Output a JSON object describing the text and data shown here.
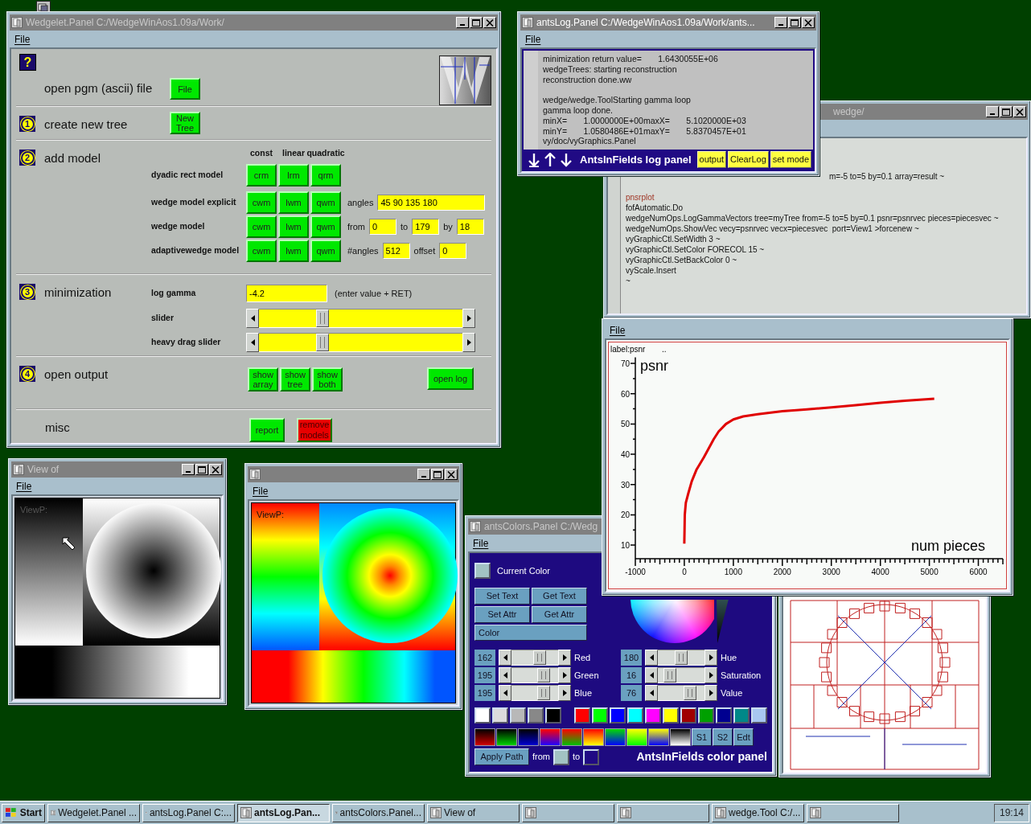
{
  "editor_window": {
    "title": "wedge/",
    "active": false,
    "lines": [
      {
        "kind": "tail",
        "text": "m=-5 to=5 by=0.1 array=result ~"
      },
      {
        "kind": "blank"
      },
      {
        "kind": "label",
        "text": "pnsrplot"
      },
      {
        "kind": "code",
        "text": "fofAutomatic.Do"
      },
      {
        "kind": "code",
        "text": "wedgeNumOps.LogGammaVectors tree=myTree from=-5 to=5 by=0.1 psnr=psnrvec pieces=piecesvec ~"
      },
      {
        "kind": "code",
        "text": "wedgeNumOps.ShowVec vecy=psnrvec vecx=piecesvec  port=View1 >forcenew ~"
      },
      {
        "kind": "code",
        "text": "vyGraphicCtl.SetWidth 3 ~"
      },
      {
        "kind": "code",
        "text": "vyGraphicCtl.SetColor FORECOL 15 ~"
      },
      {
        "kind": "code",
        "text": "vyGraphicCtl.SetBackColor 0 ~"
      },
      {
        "kind": "code",
        "text": "vyScale.Insert"
      },
      {
        "kind": "code",
        "text": "~"
      }
    ]
  },
  "wedgelet_panel": {
    "title": "Wedgelet.Panel C:/WedgeWinAos1.09a/Work/",
    "active": false,
    "menu": [
      "File"
    ],
    "help_glyph": "?",
    "open_file": {
      "label": "open pgm (ascii) file",
      "button": "File"
    },
    "sections": [
      {
        "step": "1",
        "title": "create new tree",
        "kind": "single",
        "button": "New Tree"
      },
      {
        "step": "2",
        "title": "add model",
        "kind": "models",
        "columns": [
          "const",
          "linear",
          "quadratic"
        ],
        "rows": [
          {
            "label": "dyadic rect model",
            "buttons": [
              "crm",
              "lrm",
              "qrm"
            ]
          },
          {
            "label": "wedge model explicit",
            "buttons": [
              "cwm",
              "lwm",
              "qwm"
            ],
            "fields": [
              {
                "label": "angles",
                "value": "45 90 135 180"
              }
            ]
          },
          {
            "label": "wedge model",
            "buttons": [
              "cwm",
              "lwm",
              "qwm"
            ],
            "fields": [
              {
                "label": "from",
                "value": "0"
              },
              {
                "label": "to",
                "value": "179"
              },
              {
                "label": "by",
                "value": "18"
              }
            ]
          },
          {
            "label": "adaptivewedge model",
            "buttons": [
              "cwm",
              "lwm",
              "qwm"
            ],
            "fields": [
              {
                "label": "#angles",
                "value": "512"
              },
              {
                "label": "offset",
                "value": "0"
              }
            ]
          }
        ]
      },
      {
        "step": "3",
        "title": "minimization",
        "kind": "minimization",
        "gamma": {
          "label": "log gamma",
          "value": "-4.2",
          "hint": "(enter value + RET)"
        },
        "sliders": [
          {
            "label": "slider",
            "level": 0.3
          },
          {
            "label": "heavy drag slider",
            "level": 0.3
          }
        ]
      },
      {
        "step": "4",
        "title": "open output",
        "kind": "output",
        "buttons": [
          "show array",
          "show tree",
          "show both"
        ],
        "log_button": "open log"
      },
      {
        "title": "misc",
        "kind": "misc",
        "buttons": [
          {
            "label": "report",
            "color": "#00e800"
          },
          {
            "label": "remove models",
            "color": "#e80000"
          }
        ]
      }
    ]
  },
  "antslog_panel": {
    "title": "antsLog.Panel C:/WedgeWinAos1.09a/Work/ants...",
    "active": true,
    "menu": [
      "File"
    ],
    "lines": [
      {
        "kind": "text",
        "text": "minimization return value=       1.6430055E+06"
      },
      {
        "kind": "text",
        "text": "wedgeTrees: starting reconstruction"
      },
      {
        "kind": "text",
        "text": "reconstruction done.ww"
      },
      {
        "kind": "blank"
      },
      {
        "kind": "text",
        "text": "wedge/wedge.ToolStarting gamma loop"
      },
      {
        "kind": "text",
        "text": "gamma loop done."
      },
      {
        "kind": "text",
        "text": "minX=       1.0000000E+00maxX=       5.1020000E+03"
      },
      {
        "kind": "text",
        "text": "minY=       1.0580486E+01maxY=       5.8370457E+01"
      },
      {
        "kind": "text",
        "text": "vy/doc/vyGraphics.Panel"
      }
    ],
    "footer_title": "AntsInFields log panel",
    "buttons": [
      "output",
      "ClearLog",
      "set mode"
    ]
  },
  "colors_panel": {
    "title": "antsColors.Panel C:/Wedg",
    "active": false,
    "menu": [
      "File"
    ],
    "current_color": {
      "label": "Current Color",
      "color": "#a2c3c3"
    },
    "buttons": [
      "Set Text",
      "Get Text",
      "Set Attr",
      "Get Attr"
    ],
    "color_field": "Color",
    "rgb": [
      {
        "label": "Red",
        "value": "162",
        "level": 0.64
      },
      {
        "label": "Green",
        "value": "195",
        "level": 0.76
      },
      {
        "label": "Blue",
        "value": "195",
        "level": 0.76
      }
    ],
    "hsv": [
      {
        "label": "Hue",
        "value": "180",
        "level": 0.5
      },
      {
        "label": "Saturation",
        "value": "16",
        "level": 0.16
      },
      {
        "label": "Value",
        "value": "76",
        "level": 0.76
      }
    ],
    "gray_swatches": [
      {
        "color": "#ffffff"
      },
      {
        "color": "#dcdcdc"
      },
      {
        "color": "#b8b8b8"
      },
      {
        "color": "#888888"
      },
      {
        "color": "#000000"
      }
    ],
    "color_swatches": [
      {
        "color": "#ff0000"
      },
      {
        "color": "#00ff00"
      },
      {
        "color": "#0000ff"
      },
      {
        "color": "#00ffff"
      },
      {
        "color": "#ff00ff"
      },
      {
        "color": "#ffff00"
      },
      {
        "color": "#a00000"
      },
      {
        "color": "#00a000"
      },
      {
        "color": "#000090"
      },
      {
        "color": "#008888"
      },
      {
        "color": "#a8c8f0"
      }
    ],
    "slot_buttons": [
      "S1",
      "S2",
      "Edt"
    ],
    "apply_button": "Apply Path",
    "from_swatch": {
      "label": "from",
      "color": "#a2c3c3"
    },
    "to_swatch": {
      "label": "to",
      "color": "#200a84"
    },
    "footer_title": "AntsInFields color panel"
  },
  "plot_window": {
    "menu": [
      "File"
    ],
    "plot_label": "label:psnr",
    "marker": "..",
    "chart_data": {
      "type": "line",
      "xlabel": "num pieces",
      "ylabel": "psnr",
      "xlim": [
        -1000,
        6500
      ],
      "ylim": [
        5.5,
        72
      ],
      "xticks": [
        -1000,
        0,
        1000,
        2000,
        3000,
        4000,
        5000,
        6000
      ],
      "yticks": [
        10,
        20,
        30,
        40,
        50,
        60,
        70
      ],
      "x": [
        0,
        5,
        10,
        30,
        80,
        150,
        250,
        400,
        500,
        600,
        700,
        850,
        1000,
        1200,
        1500,
        2000,
        2500,
        3000,
        3500,
        4000,
        4500,
        5100
      ],
      "series": [
        {
          "color": "#e00000",
          "values": [
            10.5,
            15,
            20,
            24,
            27,
            31,
            35,
            39,
            42,
            45,
            47.5,
            50,
            51.5,
            52.5,
            53.2,
            54.2,
            54.8,
            55.5,
            56.2,
            57,
            57.7,
            58.3
          ]
        }
      ]
    }
  },
  "view_window": {
    "title": "View of",
    "active": false,
    "menu": [
      "File"
    ],
    "overlay_text": "ViewP:"
  },
  "color_view_window": {
    "menu": [
      "File"
    ],
    "overlay_text": "ViewP:"
  },
  "taskbar": {
    "start": "Start",
    "tasks": [
      {
        "label": "Wedgelet.Panel ...",
        "selected": false
      },
      {
        "label": "antsLog.Panel C:...",
        "selected": false
      },
      {
        "label": "antsLog.Pan...",
        "selected": true
      },
      {
        "label": "antsColors.Panel...",
        "selected": false
      },
      {
        "label": "View of",
        "selected": false
      },
      {
        "selected": false
      },
      {
        "selected": false
      },
      {
        "label": "wedge.Tool C:/...",
        "selected": false
      },
      {
        "selected": false
      }
    ],
    "clock": "19:14"
  }
}
